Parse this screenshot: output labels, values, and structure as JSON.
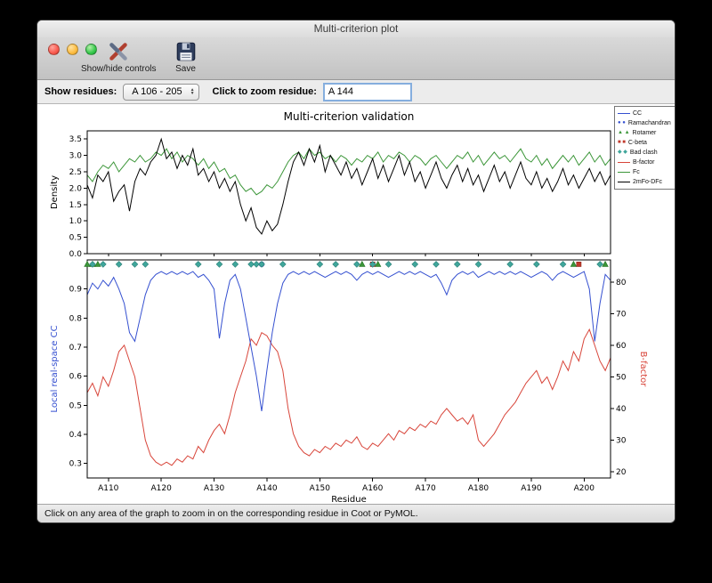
{
  "window": {
    "title": "Multi-criterion plot",
    "toolbar": {
      "show_hide_label": "Show/hide controls",
      "save_label": "Save"
    },
    "controls": {
      "show_residues_label": "Show residues:",
      "residue_range_value": "A 106 - 205",
      "zoom_label": "Click to zoom residue:",
      "zoom_value": "A 144"
    },
    "status_text": "Click on any area of the graph to zoom in on the corresponding residue in Coot or PyMOL."
  },
  "chart_data": {
    "type": "line",
    "title": "Multi-criterion validation",
    "xlabel": "Residue",
    "x_start": 106,
    "x_end": 205,
    "x_tick_labels": [
      "A110",
      "A120",
      "A130",
      "A140",
      "A150",
      "A160",
      "A170",
      "A180",
      "A190",
      "A200"
    ],
    "top": {
      "ylabel": "Density",
      "ylim": [
        0,
        3.75
      ],
      "yticks": [
        "0.0",
        "0.5",
        "1.0",
        "1.5",
        "2.0",
        "2.5",
        "3.0",
        "3.5"
      ],
      "series": [
        {
          "name": "Fc",
          "color": "#3c9639",
          "values": [
            2.4,
            2.2,
            2.5,
            2.7,
            2.6,
            2.8,
            2.5,
            2.7,
            2.9,
            2.8,
            3.0,
            2.8,
            2.9,
            3.1,
            3.0,
            3.2,
            2.9,
            3.1,
            2.8,
            3.0,
            2.9,
            2.7,
            2.9,
            2.6,
            2.8,
            2.5,
            2.6,
            2.3,
            2.4,
            2.1,
            1.9,
            2.0,
            1.8,
            1.9,
            2.1,
            2.0,
            2.2,
            2.5,
            2.8,
            3.0,
            3.1,
            2.9,
            3.2,
            3.0,
            3.1,
            2.9,
            3.0,
            2.8,
            3.0,
            2.9,
            2.7,
            2.9,
            2.8,
            3.0,
            2.9,
            3.1,
            2.8,
            3.0,
            2.9,
            3.1,
            3.0,
            2.8,
            3.0,
            2.9,
            2.7,
            2.9,
            3.0,
            2.8,
            2.6,
            2.8,
            3.0,
            2.9,
            3.1,
            2.8,
            3.0,
            2.7,
            2.9,
            3.1,
            2.9,
            3.0,
            2.8,
            3.0,
            3.2,
            2.9,
            2.8,
            3.0,
            2.7,
            2.9,
            2.6,
            2.8,
            3.0,
            2.8,
            3.0,
            2.7,
            2.9,
            3.1,
            2.8,
            3.0,
            2.7,
            2.9
          ]
        },
        {
          "name": "2mFo-DFc",
          "color": "#000000",
          "values": [
            2.1,
            1.7,
            2.4,
            2.2,
            2.5,
            1.6,
            1.9,
            2.1,
            1.3,
            2.2,
            2.6,
            2.4,
            2.8,
            3.0,
            3.5,
            2.9,
            3.1,
            2.6,
            3.0,
            2.7,
            3.2,
            2.4,
            2.6,
            2.2,
            2.5,
            2.0,
            2.3,
            1.9,
            2.2,
            1.5,
            1.0,
            1.4,
            0.8,
            0.6,
            1.0,
            0.7,
            0.9,
            1.5,
            2.2,
            2.8,
            3.1,
            2.7,
            3.2,
            2.8,
            3.3,
            2.5,
            3.0,
            2.7,
            2.4,
            2.8,
            2.3,
            2.6,
            2.1,
            2.5,
            2.9,
            2.3,
            2.7,
            2.2,
            2.6,
            3.0,
            2.4,
            2.8,
            2.2,
            2.5,
            2.0,
            2.4,
            2.8,
            2.3,
            2.0,
            2.4,
            2.7,
            2.2,
            2.6,
            2.1,
            2.4,
            1.9,
            2.3,
            2.7,
            2.2,
            2.5,
            2.0,
            2.4,
            2.8,
            2.3,
            2.1,
            2.5,
            2.0,
            2.3,
            1.9,
            2.2,
            2.6,
            2.1,
            2.4,
            2.0,
            2.3,
            2.6,
            2.2,
            2.5,
            2.1,
            2.4
          ]
        }
      ]
    },
    "bottom": {
      "ylabel_left": "Local real-space CC",
      "ylabel_left_color": "#3550d0",
      "ylabel_right": "B-factor",
      "ylabel_right_color": "#d8453a",
      "ylim_left": [
        0.25,
        1.0
      ],
      "yticks_left": [
        "0.3",
        "0.4",
        "0.5",
        "0.6",
        "0.7",
        "0.8",
        "0.9"
      ],
      "ylim_right": [
        18,
        87
      ],
      "yticks_right": [
        "20",
        "30",
        "40",
        "50",
        "60",
        "70",
        "80"
      ],
      "cc": {
        "name": "CC",
        "color": "#3550d0",
        "values": [
          0.88,
          0.92,
          0.9,
          0.93,
          0.91,
          0.94,
          0.9,
          0.85,
          0.75,
          0.72,
          0.8,
          0.88,
          0.93,
          0.95,
          0.96,
          0.95,
          0.96,
          0.95,
          0.96,
          0.95,
          0.96,
          0.94,
          0.95,
          0.93,
          0.9,
          0.73,
          0.85,
          0.93,
          0.95,
          0.9,
          0.8,
          0.7,
          0.6,
          0.48,
          0.62,
          0.75,
          0.85,
          0.92,
          0.95,
          0.96,
          0.95,
          0.96,
          0.95,
          0.96,
          0.95,
          0.94,
          0.95,
          0.96,
          0.95,
          0.96,
          0.95,
          0.93,
          0.95,
          0.96,
          0.95,
          0.96,
          0.95,
          0.94,
          0.95,
          0.96,
          0.95,
          0.96,
          0.95,
          0.96,
          0.95,
          0.94,
          0.95,
          0.92,
          0.88,
          0.93,
          0.95,
          0.96,
          0.95,
          0.96,
          0.94,
          0.95,
          0.96,
          0.95,
          0.96,
          0.95,
          0.96,
          0.95,
          0.96,
          0.95,
          0.94,
          0.95,
          0.96,
          0.95,
          0.93,
          0.95,
          0.96,
          0.95,
          0.94,
          0.95,
          0.96,
          0.9,
          0.72,
          0.85,
          0.95,
          0.93
        ]
      },
      "bfactor": {
        "name": "B-factor",
        "color": "#d8453a",
        "values": [
          45,
          48,
          44,
          50,
          47,
          52,
          58,
          60,
          55,
          50,
          40,
          30,
          25,
          23,
          22,
          23,
          22,
          24,
          23,
          25,
          24,
          28,
          26,
          30,
          33,
          35,
          32,
          38,
          45,
          50,
          55,
          62,
          60,
          64,
          63,
          60,
          58,
          52,
          40,
          32,
          28,
          26,
          25,
          27,
          26,
          28,
          27,
          29,
          28,
          30,
          29,
          31,
          28,
          27,
          29,
          28,
          30,
          32,
          30,
          33,
          32,
          34,
          33,
          35,
          34,
          36,
          35,
          38,
          40,
          38,
          36,
          37,
          35,
          38,
          30,
          28,
          30,
          32,
          35,
          38,
          40,
          42,
          45,
          48,
          50,
          52,
          48,
          50,
          46,
          50,
          55,
          52,
          58,
          55,
          62,
          65,
          60,
          55,
          52,
          56
        ]
      },
      "markers": [
        {
          "name": "Ramachandran",
          "shape": "circle",
          "color": "#3550d0",
          "edge": "#20309a",
          "residues": [
            139
          ]
        },
        {
          "name": "Rotamer",
          "shape": "triangle",
          "color": "#3c9639",
          "edge": "#1f6f1f",
          "residues": [
            106,
            107,
            108,
            158,
            161,
            198,
            204
          ]
        },
        {
          "name": "C-beta",
          "shape": "square",
          "color": "#c0392b",
          "edge": "#8f2a1f",
          "residues": [
            160,
            199
          ]
        },
        {
          "name": "Bad clash",
          "shape": "diamond",
          "color": "#3fa69b",
          "edge": "#2b7f77",
          "residues": [
            107,
            109,
            112,
            115,
            117,
            127,
            131,
            134,
            137,
            138,
            139,
            143,
            150,
            153,
            157,
            160,
            163,
            168,
            172,
            176,
            180,
            186,
            191,
            196,
            203
          ]
        }
      ]
    },
    "legend": [
      {
        "label": "CC",
        "swatch": "line",
        "color": "#3550d0"
      },
      {
        "label": "Ramachandran",
        "swatch": "circles",
        "color": "#3550d0"
      },
      {
        "label": "Rotamer",
        "swatch": "triangles",
        "color": "#3c9639"
      },
      {
        "label": "C-beta",
        "swatch": "squares",
        "color": "#c0392b"
      },
      {
        "label": "Bad clash",
        "swatch": "diamonds",
        "color": "#3fa69b"
      },
      {
        "label": "B-factor",
        "swatch": "line",
        "color": "#d8453a"
      },
      {
        "label": "Fc",
        "swatch": "line",
        "color": "#3c9639"
      },
      {
        "label": "2mFo-DFc",
        "swatch": "line",
        "color": "#000000"
      }
    ]
  }
}
